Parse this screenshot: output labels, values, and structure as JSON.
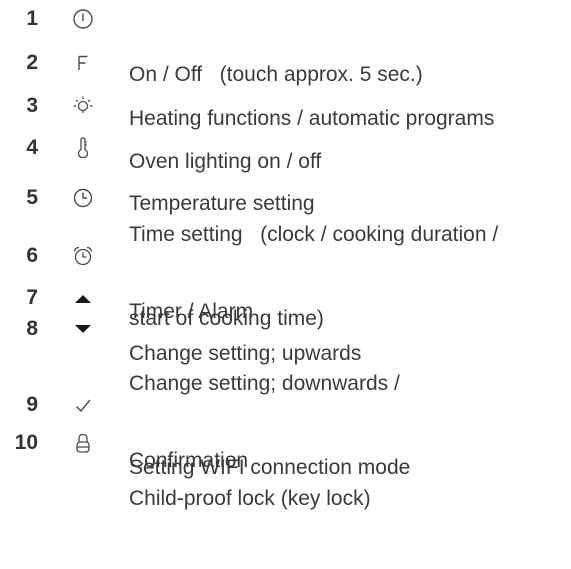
{
  "legend": {
    "items": [
      {
        "number": "1",
        "icon": "power-icon",
        "lines": [
          "On / Off   (touch approx. 5 sec.)"
        ]
      },
      {
        "number": "2",
        "icon": "function-f-icon",
        "lines": [
          "Heating functions / automatic programs"
        ]
      },
      {
        "number": "3",
        "icon": "light-bulb-icon",
        "lines": [
          "Oven lighting on / off"
        ]
      },
      {
        "number": "4",
        "icon": "thermometer-icon",
        "lines": [
          "Temperature setting"
        ]
      },
      {
        "number": "5",
        "icon": "clock-icon",
        "lines": [
          "Time setting   (clock / cooking duration /",
          "start of cooking time)"
        ]
      },
      {
        "number": "6",
        "icon": "alarm-clock-icon",
        "lines": [
          "Timer / Alarm"
        ]
      },
      {
        "number": "7",
        "icon": "arrow-up-icon",
        "lines": [
          "Change setting; upwards"
        ]
      },
      {
        "number": "8",
        "icon": "arrow-down-icon",
        "lines": [
          "Change setting; downwards /",
          "Setting WIFI connection mode"
        ]
      },
      {
        "number": "9",
        "icon": "checkmark-icon",
        "lines": [
          "Confirmation"
        ]
      },
      {
        "number": "10",
        "icon": "padlock-icon",
        "lines": [
          "Child-proof lock (key lock)"
        ]
      }
    ]
  }
}
